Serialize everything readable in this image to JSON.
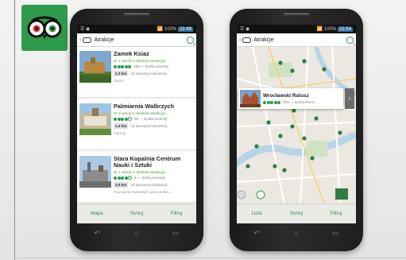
{
  "colors": {
    "brand": "#2e9b4c",
    "accent_text": "#4f9a38",
    "bar_bg": "#eaeae6"
  },
  "logo": {
    "icon": "tripadvisor-owl-icon"
  },
  "phone_left": {
    "status": {
      "icons": "☰ ◉",
      "signal": "📶 100%",
      "time": "22:49"
    },
    "search": {
      "title": "Atrakcje"
    },
    "items": [
      {
        "name": "Zamek Ksiaz",
        "rank": "Nr 1 wśród 6 obiektów atrakcyjn...",
        "rating": "160 — liczba recenzji",
        "distance": "2,3 km",
        "distance_note": "od aktualnej lokalizacji",
        "category": "Zamki",
        "stars": 5
      },
      {
        "name": "Palmiarnia Walbrzych",
        "rank": "Nr 2 wśród 6 obiektów atrakcyjn...",
        "rating": "36 — liczba recenzji",
        "distance": "1,9 km",
        "distance_note": "od aktualnej lokalizacji",
        "category": "Ogrody",
        "stars": 4
      },
      {
        "name": "Stara Kopalnia Centrum Nauki i Sztuki",
        "rank": "Nr 1 wśród 6 obiektów atrakcyjn...",
        "rating": "5 — liczba recenzji",
        "distance": "3,9 km",
        "distance_note": "od aktualnej lokalizacji",
        "category": "Pracownie malarskie i garncarskie,...",
        "stars": 4
      }
    ],
    "tabs": [
      "Mapa",
      "Sortuj",
      "Filtruj"
    ]
  },
  "phone_right": {
    "status": {
      "icons": "☰ ◉",
      "signal": "📶 100%",
      "time": "22:54"
    },
    "search": {
      "title": "Atrakcje"
    },
    "popup": {
      "name": "Wrocławski Ratusz",
      "rating": "203 — liczba recen..."
    },
    "tabs": [
      "Lista",
      "Sortuj",
      "Filtruj"
    ]
  }
}
